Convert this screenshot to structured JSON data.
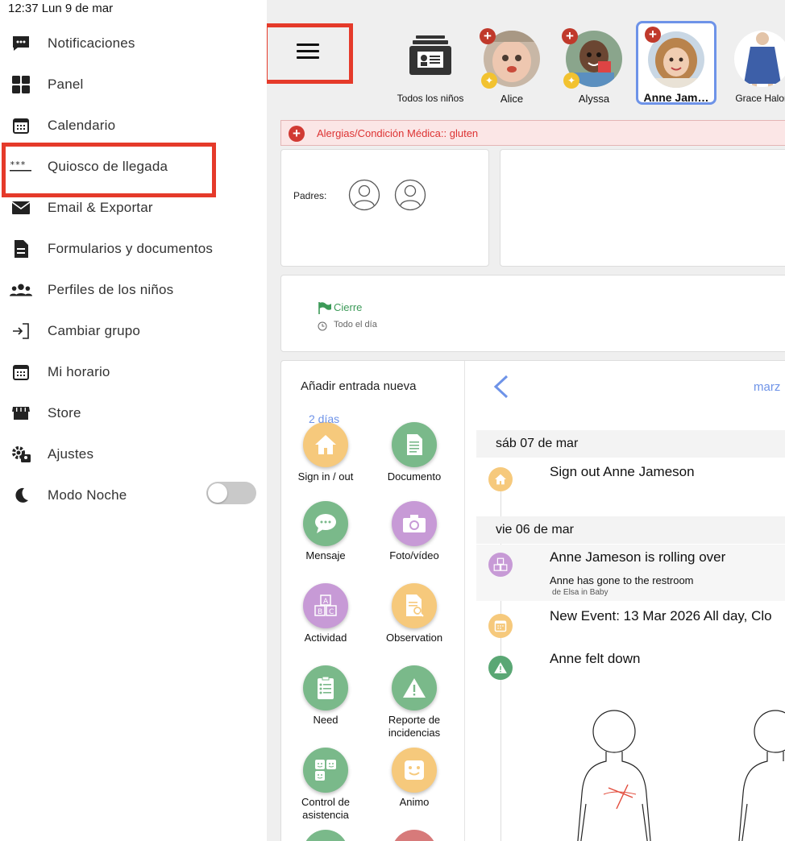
{
  "status_bar": {
    "time_date": "12:37  Lun 9 de mar"
  },
  "sidebar": {
    "items": [
      {
        "label": "Notificaciones",
        "icon": "chat-icon"
      },
      {
        "label": "Panel",
        "icon": "grid-icon"
      },
      {
        "label": "Calendario",
        "icon": "calendar-icon"
      },
      {
        "label": "Quiosco de llegada",
        "icon": "kiosk-dots-icon"
      },
      {
        "label": "Email & Exportar",
        "icon": "mail-icon"
      },
      {
        "label": "Formularios y documentos",
        "icon": "document-icon"
      },
      {
        "label": "Perfiles de los niños",
        "icon": "people-icon"
      },
      {
        "label": "Cambiar grupo",
        "icon": "switch-icon"
      },
      {
        "label": "Mi horario",
        "icon": "schedule-icon"
      },
      {
        "label": "Store",
        "icon": "store-icon"
      },
      {
        "label": "Ajustes",
        "icon": "settings-icon"
      },
      {
        "label": "Modo Noche",
        "icon": "moon-icon"
      }
    ],
    "night_mode_on": false
  },
  "children_bar": {
    "all_label": "Todos los niños",
    "children": [
      {
        "name": "Alice"
      },
      {
        "name": "Alyssa"
      },
      {
        "name": "Anne Jam…"
      },
      {
        "name": "Grace Halon"
      }
    ]
  },
  "allergy": {
    "text": "Alergias/Condición Médica:: gluten"
  },
  "parents": {
    "label": "Padres:"
  },
  "closing": {
    "title": "Cierre",
    "subtitle": "Todo el día"
  },
  "add_entry": {
    "title": "Añadir entrada nueva",
    "days_label": "2 días",
    "entries": [
      {
        "label": "Sign in / out",
        "icon": "home-icon",
        "color": "#f6c97c"
      },
      {
        "label": "Documento",
        "icon": "document-icon",
        "color": "#7ab98a"
      },
      {
        "label": "Mensaje",
        "icon": "message-icon",
        "color": "#7ab98a"
      },
      {
        "label": "Foto/vídeo",
        "icon": "camera-icon",
        "color": "#c79ad6"
      },
      {
        "label": "Actividad",
        "icon": "blocks-icon",
        "color": "#c79ad6"
      },
      {
        "label": "Observation",
        "icon": "observation-icon",
        "color": "#f6c97c"
      },
      {
        "label": "Need",
        "icon": "checklist-icon",
        "color": "#7ab98a"
      },
      {
        "label": "Reporte de incidencias",
        "icon": "warning-icon",
        "color": "#7ab98a"
      },
      {
        "label": "Control de asistencia",
        "icon": "faces-icon",
        "color": "#7ab98a"
      },
      {
        "label": "Animo",
        "icon": "smile-icon",
        "color": "#f6c97c"
      }
    ]
  },
  "timeline": {
    "month_label": "marz",
    "days": [
      {
        "header": "sáb 07 de mar"
      },
      {
        "header": "vie 06 de mar"
      }
    ],
    "events": [
      {
        "text": "Sign out Anne Jameson",
        "icon": "home-icon",
        "color": "#f6c97c"
      },
      {
        "text": "Anne Jameson is rolling over",
        "sub": "Anne has gone to the restroom",
        "subsub": "de Elsa in Baby",
        "icon": "blocks-icon",
        "color": "#c79ad6"
      },
      {
        "text": "New Event: 13 Mar 2026 All day, Clo",
        "icon": "calendar-icon",
        "color": "#f6c97c"
      },
      {
        "text": "Anne felt down",
        "icon": "warning-icon",
        "color": "#5aa774"
      }
    ]
  }
}
